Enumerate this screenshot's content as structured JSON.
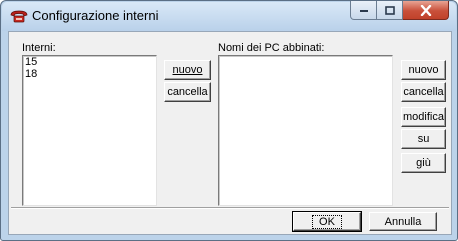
{
  "window": {
    "title": "Configurazione interni",
    "title_icon": "telephone-icon",
    "controls": {
      "minimize": "minimize-icon",
      "maximize": "maximize-icon",
      "close": "close-icon"
    }
  },
  "left": {
    "label": "Interni:",
    "items": [
      "15",
      "18"
    ]
  },
  "middle_buttons": {
    "new": "nuovo",
    "delete": "cancella"
  },
  "right": {
    "label": "Nomi dei PC abbinati:",
    "items": []
  },
  "right_buttons": {
    "new": "nuovo",
    "delete": "cancella",
    "edit": "modifica",
    "up": "su",
    "down": "giù"
  },
  "footer": {
    "ok": "OK",
    "cancel": "Annulla"
  }
}
